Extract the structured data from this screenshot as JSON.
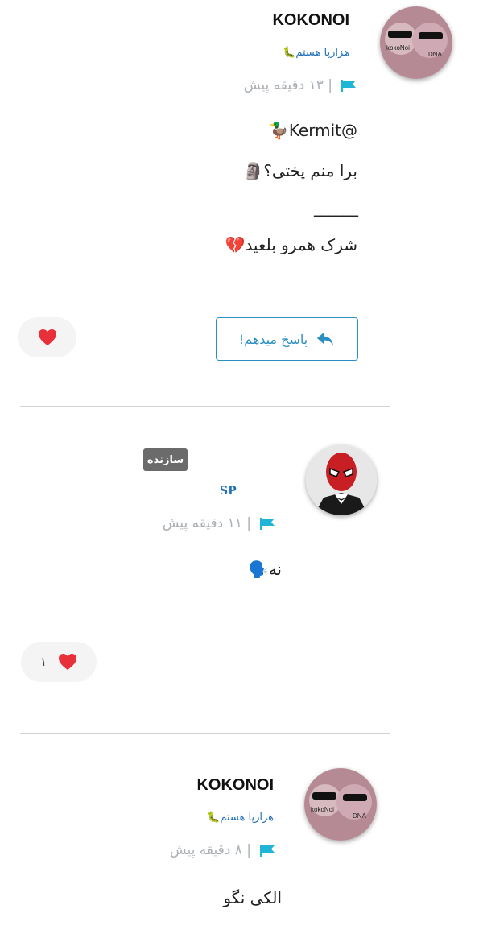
{
  "comments": [
    {
      "username": "KOKONOI",
      "subtitle": "هزارپا هستم🐛",
      "time": "| ۱۳ دقیقه پیش",
      "avatar_label_left": "kokoNoi",
      "avatar_label_right": "DNA",
      "lines": [
        "@Kermit🦆",
        "برا منم پختی؟🗿",
        "______",
        "شرک همرو بلعید💔"
      ],
      "reply_label": "پاسخ میدهم!",
      "like_count": ""
    },
    {
      "username": "SP",
      "badge": "سازنده",
      "time": "| ۱۱ دقیقه پیش",
      "lines": [
        "نه🗣️"
      ],
      "like_count": "۱"
    },
    {
      "username": "KOKONOI",
      "subtitle": "هزارپا هستم🐛",
      "time": "| ۸ دقیقه پیش",
      "avatar_label_left": "kokoNoi",
      "avatar_label_right": "DNA",
      "lines": [
        "الکی نگو"
      ]
    }
  ],
  "icons": {
    "flag": "flag-icon",
    "heart": "heart-icon",
    "reply": "reply-arrow-icon"
  },
  "colors": {
    "accent": "#2a8fc2",
    "flag": "#1fb5d6",
    "heart": "#e8303a",
    "badge": "#6b6b6b"
  }
}
